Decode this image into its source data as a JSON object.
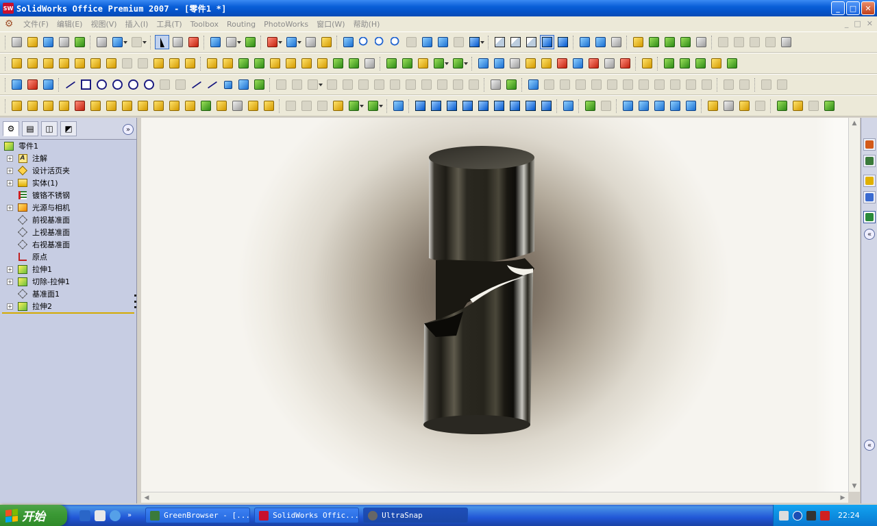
{
  "window": {
    "title": "SolidWorks Office Premium 2007 - [零件1 *]",
    "logo_text": "SW",
    "minimize": "_",
    "maximize": "□",
    "close": "✕"
  },
  "menubar": {
    "items": [
      "文件(F)",
      "编辑(E)",
      "视图(V)",
      "插入(I)",
      "工具(T)",
      "Toolbox",
      "Routing",
      "PhotoWorks",
      "窗口(W)",
      "帮助(H)"
    ],
    "mdi_minimize": "_",
    "mdi_restore": "□",
    "mdi_close": "✕"
  },
  "feature_manager": {
    "tabs": [
      "feature-manager",
      "property-manager",
      "configuration-manager",
      "display-manager"
    ],
    "expand_label": "»",
    "root": "零件1",
    "items": [
      {
        "label": "注解",
        "icon": "annotations-icon",
        "expandable": true
      },
      {
        "label": "设计活页夹",
        "icon": "design-binder-icon",
        "expandable": true
      },
      {
        "label": "实体(1)",
        "icon": "solid-bodies-icon",
        "expandable": true
      },
      {
        "label": "镀铬不锈钢",
        "icon": "material-icon",
        "expandable": false
      },
      {
        "label": "光源与相机",
        "icon": "lights-cameras-icon",
        "expandable": true
      },
      {
        "label": "前视基准面",
        "icon": "plane-icon",
        "expandable": false
      },
      {
        "label": "上视基准面",
        "icon": "plane-icon",
        "expandable": false
      },
      {
        "label": "右视基准面",
        "icon": "plane-icon",
        "expandable": false
      },
      {
        "label": "原点",
        "icon": "origin-icon",
        "expandable": false
      },
      {
        "label": "拉伸1",
        "icon": "extrude-icon",
        "expandable": true
      },
      {
        "label": "切除-拉伸1",
        "icon": "cut-extrude-icon",
        "expandable": true
      },
      {
        "label": "基准面1",
        "icon": "plane-icon",
        "expandable": false
      },
      {
        "label": "拉伸2",
        "icon": "extrude-icon",
        "expandable": true
      }
    ]
  },
  "taskbar": {
    "start_label": "开始",
    "tasks": [
      {
        "label": "GreenBrowser - [...",
        "active": false,
        "color": "#3a7a3a"
      },
      {
        "label": "SolidWorks Offic...",
        "active": false,
        "color": "#c8102e"
      },
      {
        "label": "UltraSnap",
        "active": true,
        "color": "#666666"
      }
    ],
    "quicklaunch_more": "»",
    "clock": "22:24"
  },
  "colors": {
    "title_bar": "#0553c9",
    "menu_bg": "#ece9d8",
    "panel_bg": "#c7cde3",
    "taskbar": "#2157d7",
    "tray": "#0d8ee0",
    "start_green": "#3c9a36"
  }
}
